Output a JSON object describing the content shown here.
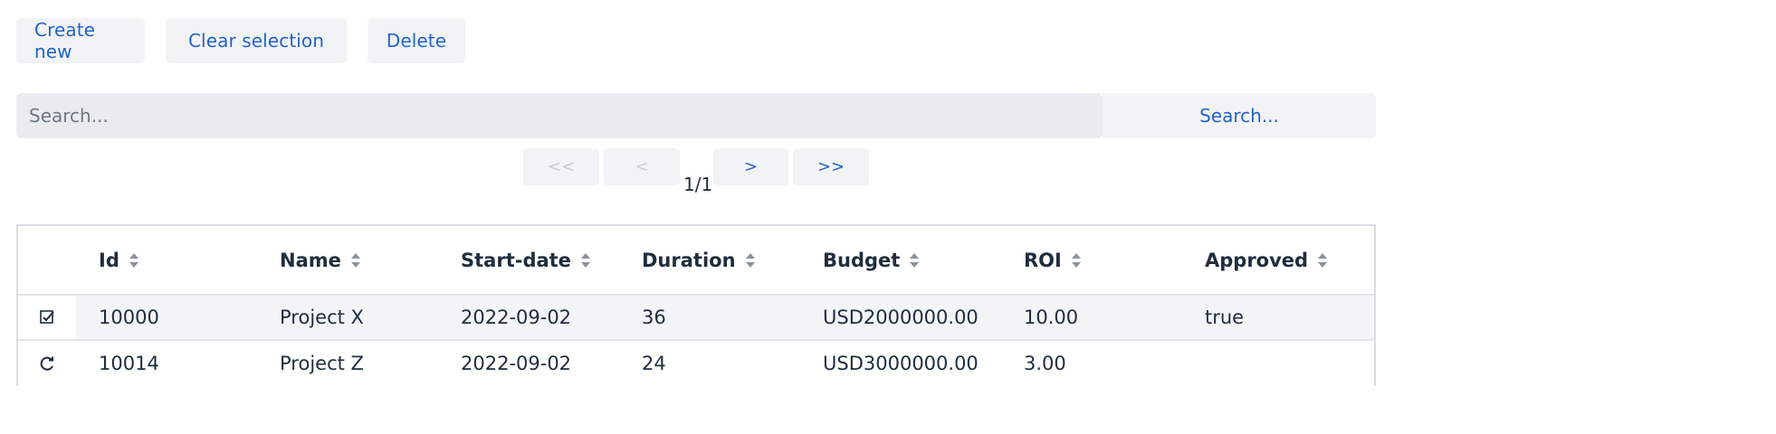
{
  "toolbar": {
    "create_label": "Create new",
    "clear_label": "Clear selection",
    "delete_label": "Delete"
  },
  "search": {
    "placeholder": "Search...",
    "button_label": "Search..."
  },
  "pagination": {
    "first_label": "<<",
    "prev_label": "<",
    "next_label": ">",
    "last_label": ">>",
    "status": "1/1"
  },
  "table": {
    "columns": [
      "Id",
      "Name",
      "Start-date",
      "Duration",
      "Budget",
      "ROI",
      "Approved"
    ],
    "rows": [
      {
        "state_icon": "checked-box-icon",
        "cells": [
          "10000",
          "Project X",
          "2022-09-02",
          "36",
          "USD2000000.00",
          "10.00",
          "true"
        ]
      },
      {
        "state_icon": "refresh-icon",
        "cells": [
          "10014",
          "Project Z",
          "2022-09-02",
          "24",
          "USD3000000.00",
          "3.00",
          ""
        ]
      }
    ]
  },
  "colors": {
    "accent": "#2363c8",
    "button_bg": "#f2f3f5",
    "input_bg": "#e9ebee",
    "text": "#1f2d3d",
    "disabled": "#c6ccd4",
    "border": "#d9dde2"
  }
}
